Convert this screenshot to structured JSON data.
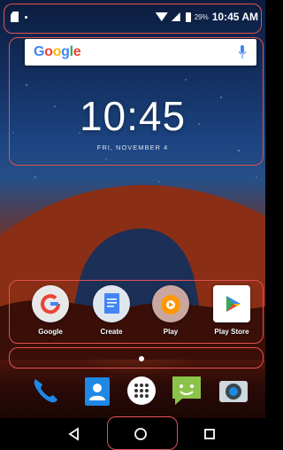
{
  "status_bar": {
    "battery_percent": "29%",
    "time": "10:45 AM"
  },
  "search_bar": {
    "logo_text": "Google"
  },
  "clock": {
    "time": "10:45",
    "date": "FRI, NOVEMBER 4"
  },
  "apps": [
    {
      "label": "Google",
      "icon": "google-icon"
    },
    {
      "label": "Create",
      "icon": "docs-icon"
    },
    {
      "label": "Play",
      "icon": "play-music-icon"
    },
    {
      "label": "Play Store",
      "icon": "play-store-icon"
    }
  ],
  "dock": [
    {
      "icon": "phone-icon"
    },
    {
      "icon": "contacts-icon"
    },
    {
      "icon": "app-drawer-icon"
    },
    {
      "icon": "messaging-icon"
    },
    {
      "icon": "camera-icon"
    }
  ],
  "nav": {
    "back": "back-icon",
    "home": "home-icon",
    "recents": "recents-icon"
  },
  "colors": {
    "highlight": "#e05353",
    "google_blue": "#4285f4"
  }
}
